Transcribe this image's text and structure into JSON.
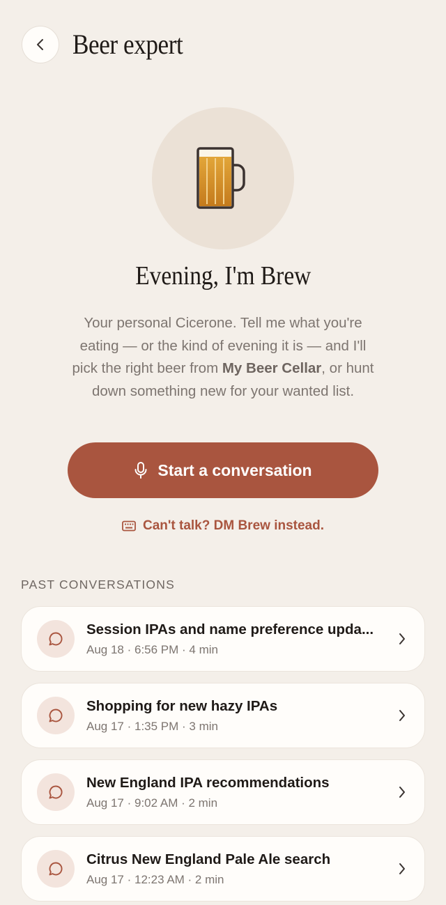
{
  "header": {
    "title": "Beer expert",
    "back_icon": "chevron-left-icon"
  },
  "hero": {
    "avatar_icon": "beer-mug-icon",
    "greeting": "Evening, I'm Brew",
    "intro_before": "Your personal Cicerone. Tell me what you're eating — or the kind of evening it is — and I'll pick the right beer from ",
    "intro_bold": "My Beer Cellar",
    "intro_after": ", or hunt down something new for your wanted list."
  },
  "actions": {
    "start_label": "Start a conversation",
    "start_icon": "microphone-icon",
    "dm_label": "Can't talk? DM Brew instead.",
    "dm_icon": "keyboard-icon"
  },
  "past": {
    "label": "PAST CONVERSATIONS",
    "items": [
      {
        "title": "Session IPAs and name preference upda...",
        "meta": "Aug 18 · 6:56 PM · 4 min"
      },
      {
        "title": "Shopping for new hazy IPAs",
        "meta": "Aug 17 · 1:35 PM · 3 min"
      },
      {
        "title": "New England IPA recommendations",
        "meta": "Aug 17 · 9:02 AM · 2 min"
      },
      {
        "title": "Citrus New England Pale Ale search",
        "meta": "Aug 17 · 12:23 AM · 2 min"
      }
    ]
  },
  "colors": {
    "background": "#f4efe9",
    "accent": "#a9553f",
    "card": "#fffdfa",
    "icon_bg": "#f3e4dd"
  }
}
